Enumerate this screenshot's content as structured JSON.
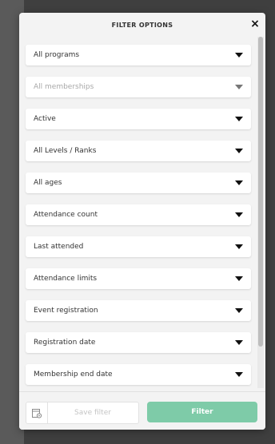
{
  "modal": {
    "title": "FILTER OPTIONS",
    "close_label": "×"
  },
  "filters": [
    {
      "label": "All programs",
      "disabled": false
    },
    {
      "label": "All memberships",
      "disabled": true
    },
    {
      "label": "Active",
      "disabled": false
    },
    {
      "label": "All Levels / Ranks",
      "disabled": false
    },
    {
      "label": "All ages",
      "disabled": false
    },
    {
      "label": "Attendance count",
      "disabled": false
    },
    {
      "label": "Last attended",
      "disabled": false
    },
    {
      "label": "Attendance limits",
      "disabled": false
    },
    {
      "label": "Event registration",
      "disabled": false
    },
    {
      "label": "Registration date",
      "disabled": false
    },
    {
      "label": "Membership end date",
      "disabled": false
    }
  ],
  "footer": {
    "save_label": "Save filter",
    "save_icon": "save-filter-icon",
    "filter_label": "Filter"
  },
  "colors": {
    "accent": "#7ecba8",
    "background": "#f3f3f3"
  }
}
